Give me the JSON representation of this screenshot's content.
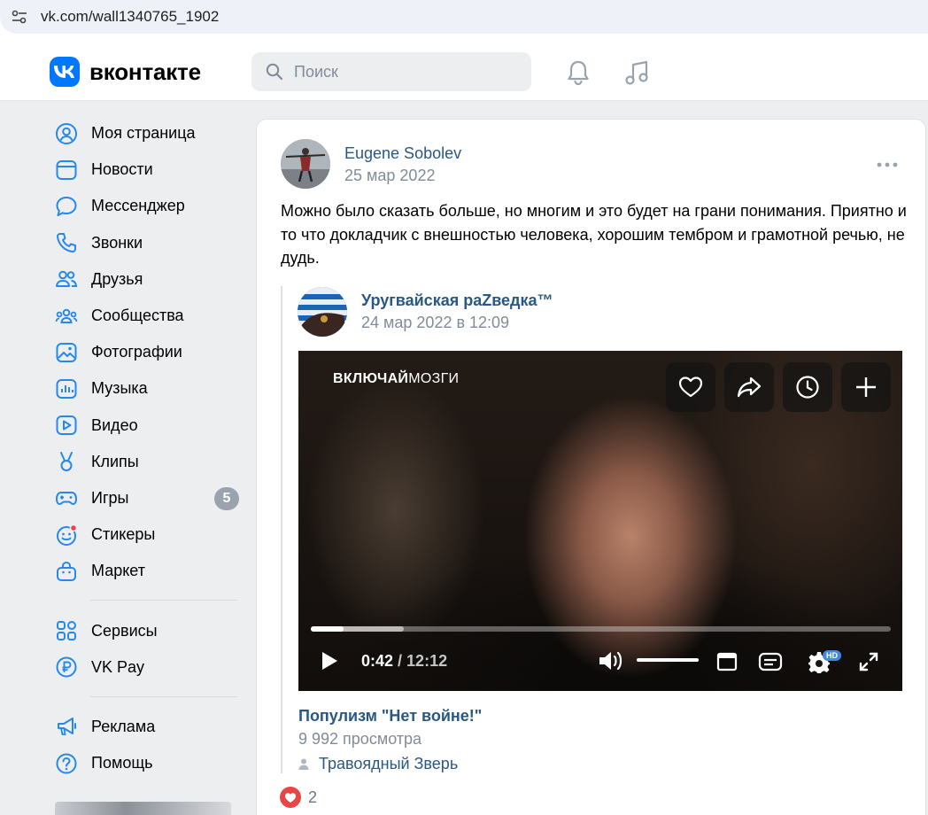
{
  "browser": {
    "url": "vk.com/wall1340765_1902"
  },
  "header": {
    "logo_text": "вконтакте",
    "search_placeholder": "Поиск"
  },
  "sidebar": {
    "items": [
      {
        "label": "Моя страница",
        "icon": "user-icon"
      },
      {
        "label": "Новости",
        "icon": "news-icon"
      },
      {
        "label": "Мессенджер",
        "icon": "message-icon"
      },
      {
        "label": "Звонки",
        "icon": "phone-icon"
      },
      {
        "label": "Друзья",
        "icon": "friends-icon"
      },
      {
        "label": "Сообщества",
        "icon": "communities-icon"
      },
      {
        "label": "Фотографии",
        "icon": "photo-icon"
      },
      {
        "label": "Музыка",
        "icon": "music-icon"
      },
      {
        "label": "Видео",
        "icon": "video-icon"
      },
      {
        "label": "Клипы",
        "icon": "clips-icon"
      },
      {
        "label": "Игры",
        "icon": "gamepad-icon",
        "badge": "5"
      },
      {
        "label": "Стикеры",
        "icon": "sticker-icon"
      },
      {
        "label": "Маркет",
        "icon": "bag-icon"
      }
    ],
    "group2": [
      {
        "label": "Сервисы",
        "icon": "services-icon"
      },
      {
        "label": "VK Pay",
        "icon": "ruble-icon"
      }
    ],
    "group3": [
      {
        "label": "Реклама",
        "icon": "megaphone-icon"
      },
      {
        "label": "Помощь",
        "icon": "help-icon"
      }
    ]
  },
  "post": {
    "author": "Eugene Sobolev",
    "date": "25 мар 2022",
    "text": "Можно было сказать больше, но многим и это будет на грани понимания. Приятно и то что докладчик с внешностью человека, хорошим тембром и грамотной речью, не дудь.",
    "repost": {
      "author": "Уругвайская раZведка™",
      "date": "24 мар 2022 в 12:09",
      "video": {
        "brand_bold": "ВКЛЮЧАЙ",
        "brand_light": "МОЗГИ",
        "current_time": "0:42",
        "duration": "/ 12:12",
        "progress_fraction": 0.057,
        "buffered_fraction": 0.16,
        "quality_badge": "HD",
        "title": "Популизм \"Нет войне!\"",
        "views": "9 992 просмотра",
        "uploader": "Травоядный Зверь"
      }
    },
    "likes_count": "2"
  },
  "colors": {
    "accent": "#0077ff",
    "link": "#2a5885",
    "secondary_text": "#818c99",
    "like_red": "#e64646",
    "hd_blue": "#3f8ae0"
  }
}
